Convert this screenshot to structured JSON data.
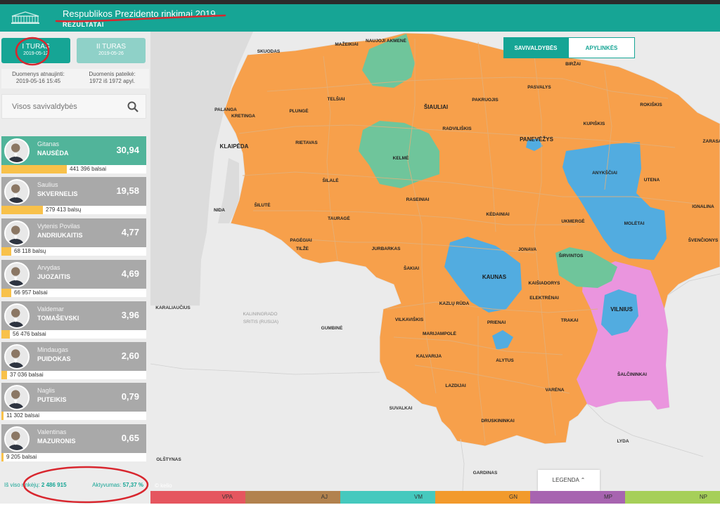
{
  "app": {
    "title": "Respublikos Prezidento rinkimai 2019",
    "subtitle": "REZULTATAI"
  },
  "rounds": [
    {
      "label": "I TURAS",
      "date": "2019-05-12"
    },
    {
      "label": "II TURAS",
      "date": "2019-05-26"
    }
  ],
  "updated": {
    "label": "Duomenys atnaujinti:",
    "value": "2019-05-16 15:45"
  },
  "reported": {
    "label": "Duomenis pateikė:",
    "value": "1972 iš 1972 apyl."
  },
  "search": {
    "placeholder": "Visos savivaldybės"
  },
  "candidates": [
    {
      "first": "Gitanas",
      "last": "NAUSĖDA",
      "pct": "30,94",
      "votes": "441 396 balsai",
      "share": 0.3094
    },
    {
      "first": "Saulius",
      "last": "SKVERNELIS",
      "pct": "19,58",
      "votes": "279 413 balsų",
      "share": 0.1958
    },
    {
      "first": "Vytenis Povilas",
      "last": "ANDRIUKAITIS",
      "pct": "4,77",
      "votes": "68 118 balsų",
      "share": 0.0477
    },
    {
      "first": "Arvydas",
      "last": "JUOZAITIS",
      "pct": "4,69",
      "votes": "66 957 balsai",
      "share": 0.0469
    },
    {
      "first": "Valdemar",
      "last": "TOMAŠEVSKI",
      "pct": "3,96",
      "votes": "56 476 balsai",
      "share": 0.0396
    },
    {
      "first": "Mindaugas",
      "last": "PUIDOKAS",
      "pct": "2,60",
      "votes": "37 036 balsai",
      "share": 0.026
    },
    {
      "first": "Naglis",
      "last": "PUTEIKIS",
      "pct": "0,79",
      "votes": "11 302 balsai",
      "share": 0.0079
    },
    {
      "first": "Valentinas",
      "last": "MAZURONIS",
      "pct": "0,65",
      "votes": "9 205 balsai",
      "share": 0.0065
    }
  ],
  "footer": {
    "voters_label": "Iš viso rinkėjų:",
    "voters": "2 486 915",
    "turnout_label": "Aktyvumas:",
    "turnout": "57,37 %"
  },
  "map": {
    "toggle": {
      "left": "SAVIVALDYBĖS",
      "right": "APYLINKĖS"
    },
    "legend_button": "LEGENDA",
    "watermark": "© kelio",
    "colors": {
      "orange": "#f7a04b",
      "green": "#6fc59b",
      "blue": "#52ace0",
      "pink": "#ea95de",
      "border": "#c9c9c9"
    },
    "labels": {
      "skuodas": "SKUODAS",
      "mazeikiai": "MAŽEIKIAI",
      "naujoji": "NAUJOJI AKMENĖ",
      "birzai": "BIRŽAI",
      "pasvalys": "PASVALYS",
      "rokiskis": "ROKIŠKIS",
      "zarasai": "ZARASAI",
      "pakruojis": "PAKRUOJIS",
      "siauliai": "ŠIAULIAI",
      "telsiai": "TELŠIAI",
      "plunge": "PLUNGĖ",
      "palanga": "PALANGA",
      "kretinga": "KRETINGA",
      "radviliskis": "RADVILIŠKIS",
      "kupiskis": "KUPIŠKIS",
      "klaipeda": "KLAIPĖDA",
      "rietavas": "RIETAVAS",
      "kelme": "KELMĖ",
      "panevezys": "PANEVĖŽYS",
      "anyksciai": "ANYKŠČIAI",
      "utena": "UTENA",
      "silale": "ŠILALĖ",
      "raseiniai": "RASEINIAI",
      "silute": "ŠILUTĖ",
      "taurage": "TAURAGĖ",
      "kedainiai": "KĖDAINIAI",
      "ignalina": "IGNALINA",
      "moletai": "MOLĖTAI",
      "ukmerge": "UKMERGĖ",
      "neringa": "NIDA",
      "pagegiai": "PAGĖGIAI",
      "tilze": "TILŽĖ",
      "jurbarkas": "JURBARKAS",
      "jonava": "JONAVA",
      "svencionys": "ŠVENČIONYS",
      "sirvintos": "ŠIRVINTOS",
      "sakiai": "ŠAKIAI",
      "kaunas": "KAUNAS",
      "kaisiadorys": "KAIŠIADORYS",
      "karaliaucius": "KARALIAUČIUS",
      "kaliningrado": "KALININGRADO",
      "sritis": "SRITIS (RUSIJA)",
      "elektrenai": "ELEKTRĖNAI",
      "vilnius": "VILNIUS",
      "kazlu": "KAZLŲ RŪDA",
      "gumbine": "GUMBINĖ",
      "vilkaviskis": "VILKAVIŠKIS",
      "prienai": "PRIENAI",
      "trakai": "TRAKAI",
      "marijampole": "MARIJAMPOLĖ",
      "alytus": "ALYTUS",
      "kalvarija": "KALVARIJA",
      "salcininkai": "ŠALČININKAI",
      "lazdijai": "LAZDIJAI",
      "varena": "VARĖNA",
      "suvalkai": "SUVALKAI",
      "druskininkai": "DRUSKININKAI",
      "lyda": "LYDA",
      "olstynas": "OLŠTYNAS",
      "gardinas": "GARDINAS"
    }
  },
  "parties": [
    {
      "code": "VPA",
      "color": "#e5565f"
    },
    {
      "code": "AJ",
      "color": "#b2824e"
    },
    {
      "code": "VM",
      "color": "#45c9be"
    },
    {
      "code": "GN",
      "color": "#f29a2c"
    },
    {
      "code": "MP",
      "color": "#a764b0"
    },
    {
      "code": "NP",
      "color": "#a6cf59"
    }
  ]
}
